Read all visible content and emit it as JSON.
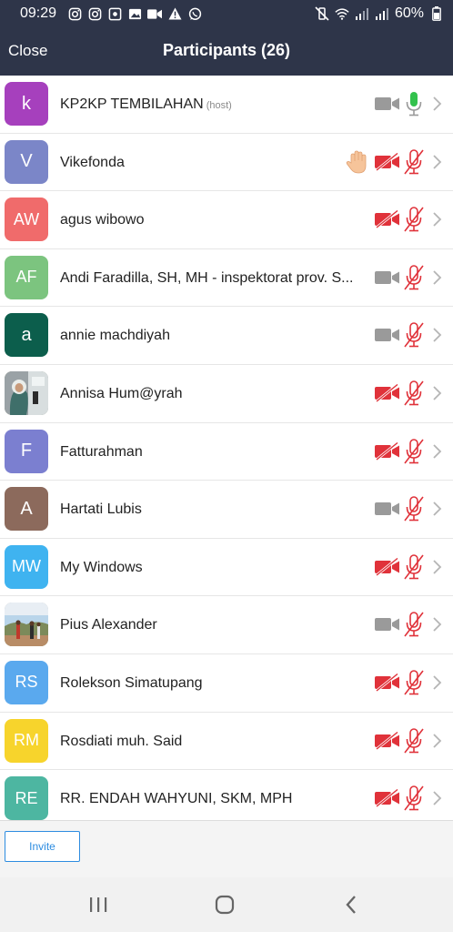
{
  "status_bar": {
    "time": "09:29",
    "battery": "60%",
    "left_icons": [
      "instagram-icon",
      "instagram-icon",
      "square-app-icon",
      "image-icon",
      "video-icon",
      "warning-icon",
      "whatsapp-icon"
    ],
    "right_icons": [
      "mute-vibrate-icon",
      "wifi-icon",
      "signal-icon",
      "signal-icon",
      "battery-icon"
    ]
  },
  "header": {
    "close_label": "Close",
    "title": "Participants (26)"
  },
  "colors": {
    "header_bg": "#2e3549",
    "muted_red": "#e0323a",
    "active_green": "#33c24d",
    "gray_icon": "#9a9a9a",
    "accent_blue": "#2d8ce0"
  },
  "participants": [
    {
      "initials": "k",
      "avatar_color": "#a640bd",
      "name": "KP2KP TEMBILAHAN",
      "tag": "(host)",
      "hand": false,
      "camera": "off-gray",
      "mic": "on-green"
    },
    {
      "initials": "V",
      "avatar_color": "#7b86c8",
      "name": "Vikefonda",
      "tag": "",
      "hand": true,
      "camera": "off-red",
      "mic": "off-red"
    },
    {
      "initials": "AW",
      "avatar_color": "#f06b6b",
      "name": "agus wibowo",
      "tag": "",
      "hand": false,
      "camera": "off-red",
      "mic": "off-red"
    },
    {
      "initials": "AF",
      "avatar_color": "#7cc47f",
      "name": "Andi Faradilla, SH, MH - inspektorat prov. S...",
      "tag": "",
      "hand": false,
      "camera": "off-gray",
      "mic": "off-red"
    },
    {
      "initials": "a",
      "avatar_color": "#0c5e4c",
      "name": "annie machdiyah",
      "tag": "",
      "hand": false,
      "camera": "off-gray",
      "mic": "off-red"
    },
    {
      "initials": "",
      "avatar_color": "#8a8f6a",
      "name": "Annisa Hum@yrah",
      "tag": "",
      "hand": false,
      "camera": "off-red",
      "mic": "off-red"
    },
    {
      "initials": "F",
      "avatar_color": "#7b7fd0",
      "name": "Fatturahman",
      "tag": "",
      "hand": false,
      "camera": "off-red",
      "mic": "off-red"
    },
    {
      "initials": "A",
      "avatar_color": "#8c6a5c",
      "name": "Hartati Lubis",
      "tag": "",
      "hand": false,
      "camera": "off-gray",
      "mic": "off-red"
    },
    {
      "initials": "MW",
      "avatar_color": "#3fb3f0",
      "name": "My Windows",
      "tag": "",
      "hand": false,
      "camera": "off-red",
      "mic": "off-red"
    },
    {
      "initials": "",
      "avatar_color": "#b78a6a",
      "name": "Pius Alexander",
      "tag": "",
      "hand": false,
      "camera": "off-gray",
      "mic": "off-red"
    },
    {
      "initials": "RS",
      "avatar_color": "#5aa9ee",
      "name": "Rolekson Simatupang",
      "tag": "",
      "hand": false,
      "camera": "off-red",
      "mic": "off-red"
    },
    {
      "initials": "RM",
      "avatar_color": "#f7d42c",
      "name": "Rosdiati muh. Said",
      "tag": "",
      "hand": false,
      "camera": "off-red",
      "mic": "off-red"
    },
    {
      "initials": "RE",
      "avatar_color": "#4db6a1",
      "name": "RR. ENDAH WAHYUNI, SKM, MPH",
      "tag": "",
      "hand": false,
      "camera": "off-red",
      "mic": "off-red"
    }
  ],
  "footer": {
    "invite_label": "Invite"
  }
}
